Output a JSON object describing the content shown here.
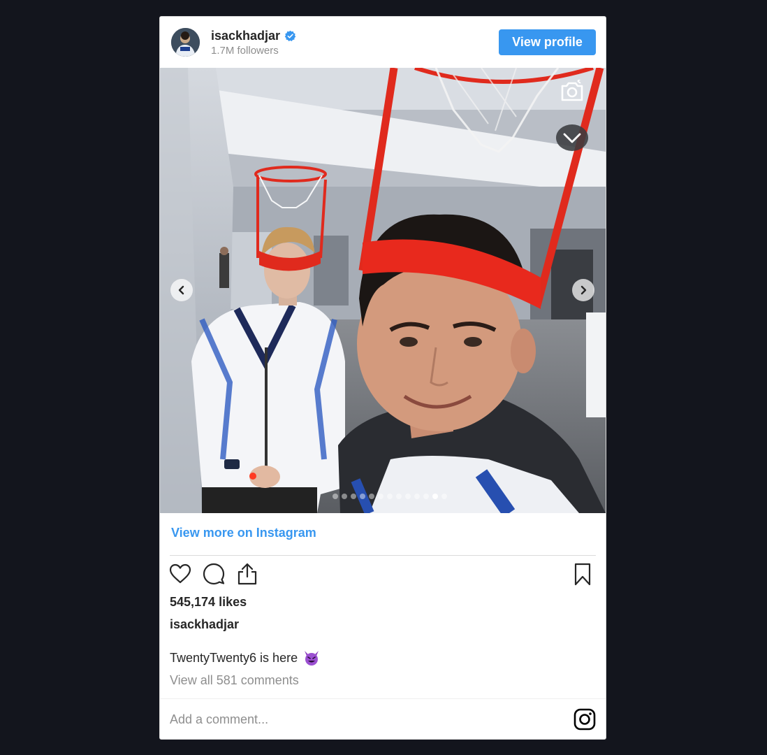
{
  "header": {
    "username": "isackhadjar",
    "followers": "1.7M followers",
    "view_profile_label": "View profile",
    "verified_icon": "verified-badge-icon"
  },
  "media": {
    "slide_count": 13,
    "active_slide": 12,
    "icons": [
      "camera-flip-icon",
      "chevron-down-icon",
      "chevron-left-icon",
      "chevron-right-icon"
    ]
  },
  "footer": {
    "view_more_label": "View more on Instagram",
    "likes": "545,174 likes",
    "caption_username": "isackhadjar",
    "caption_text": "TwentyTwenty6 is here",
    "caption_emoji": "smiling-devil-emoji",
    "view_comments": "View all 581 comments",
    "comment_placeholder": "Add a comment...",
    "action_icons": [
      "heart-icon",
      "comment-icon",
      "share-icon",
      "bookmark-icon",
      "instagram-logo-icon"
    ]
  },
  "colors": {
    "background": "#13151d",
    "accent": "#3897f0",
    "text": "#262626",
    "muted": "#8e8e8e"
  }
}
